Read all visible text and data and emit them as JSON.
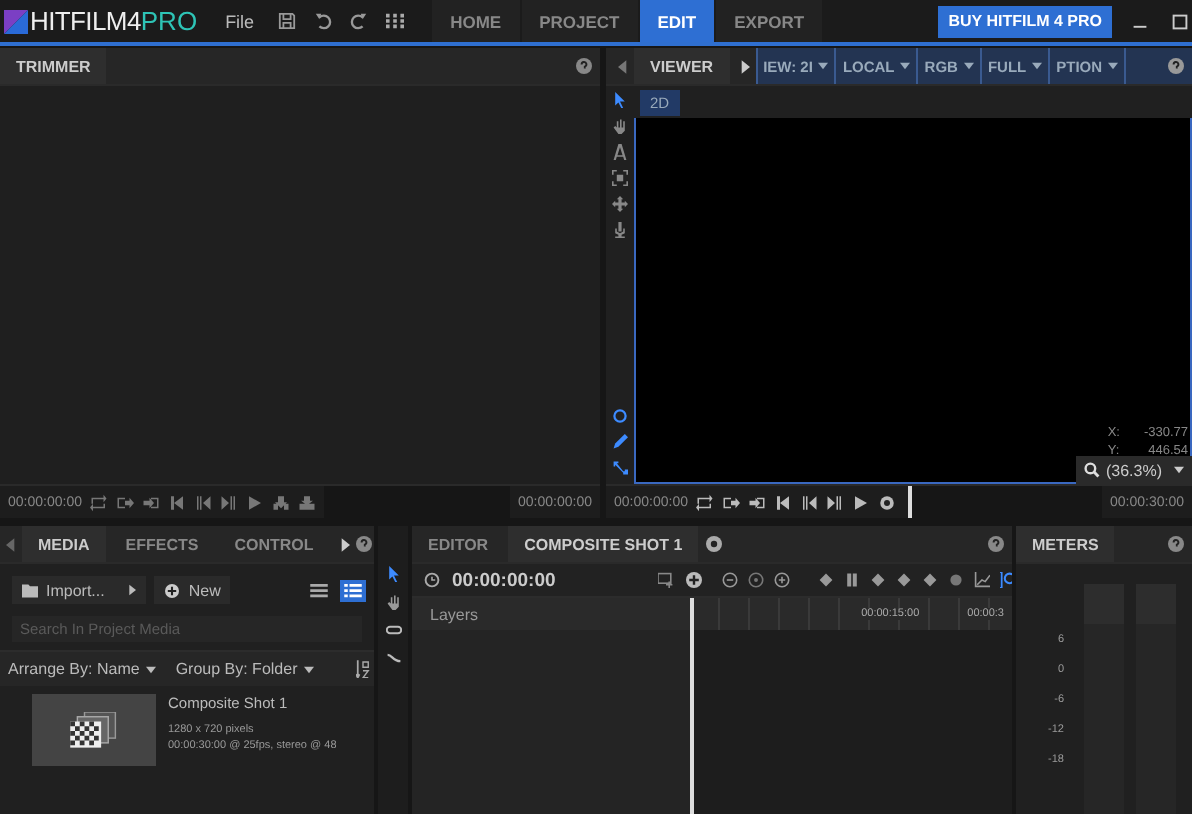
{
  "logo": {
    "main": "HITFILM4",
    "accent": "PRO"
  },
  "menu": [
    "File"
  ],
  "tabs": [
    {
      "label": "HOME",
      "selected": false
    },
    {
      "label": "PROJECT",
      "selected": false
    },
    {
      "label": "EDIT",
      "selected": true
    },
    {
      "label": "EXPORT",
      "selected": false
    }
  ],
  "buy_button": "BUY HITFILM 4 PRO",
  "trimmer": {
    "title": "TRIMMER",
    "start_time": "00:00:00:00",
    "end_time": "00:00:00:00"
  },
  "viewer": {
    "title": "VIEWER",
    "dropdowns": [
      "IEW: 2I",
      "LOCAL",
      "RGB",
      "FULL",
      "PTION"
    ],
    "mode_tag": "2D",
    "tools": [
      {
        "kind": "arrow",
        "selected": true
      },
      {
        "kind": "hand",
        "selected": false
      },
      {
        "kind": "text",
        "selected": false
      },
      {
        "kind": "crop",
        "selected": false
      },
      {
        "kind": "move",
        "selected": false
      },
      {
        "kind": "mic",
        "selected": false
      }
    ],
    "bottom_tools": [
      {
        "kind": "ellipse"
      },
      {
        "kind": "pen"
      },
      {
        "kind": "path"
      }
    ],
    "x_label": "X:",
    "x_value": "-330.77",
    "y_label": "Y:",
    "y_value": "446.54",
    "zoom": "(36.3%)",
    "start_time": "00:00:00:00",
    "end_time": "00:00:30:00"
  },
  "media": {
    "tabs": [
      {
        "label": "MEDIA",
        "selected": true
      },
      {
        "label": "EFFECTS",
        "selected": false
      },
      {
        "label": "CONTROL",
        "selected": false
      }
    ],
    "import_button": "Import...",
    "new_button": "New",
    "view_modes": [
      {
        "kind": "list",
        "selected": false
      },
      {
        "kind": "grid",
        "selected": true
      }
    ],
    "search": {
      "placeholder": "Search In Project Media"
    },
    "arrange": "Arrange By: Name",
    "group": "Group By: Folder",
    "items": [
      {
        "name": "Composite Shot 1",
        "size": "1280 x 720 pixels",
        "details": "00:00:30:00 @ 25fps, stereo @ 48"
      }
    ]
  },
  "editor": {
    "tabs": [
      {
        "label": "EDITOR",
        "selected": false
      },
      {
        "label": "COMPOSITE SHOT 1",
        "selected": true
      }
    ],
    "time": "00:00:00:00",
    "layers_label": "Layers",
    "ruler": [
      "00:00:15:00",
      "00:00:3"
    ]
  },
  "meters": {
    "title": "METERS",
    "scale": [
      "6",
      "0",
      "-6",
      "-12",
      "-18"
    ]
  }
}
